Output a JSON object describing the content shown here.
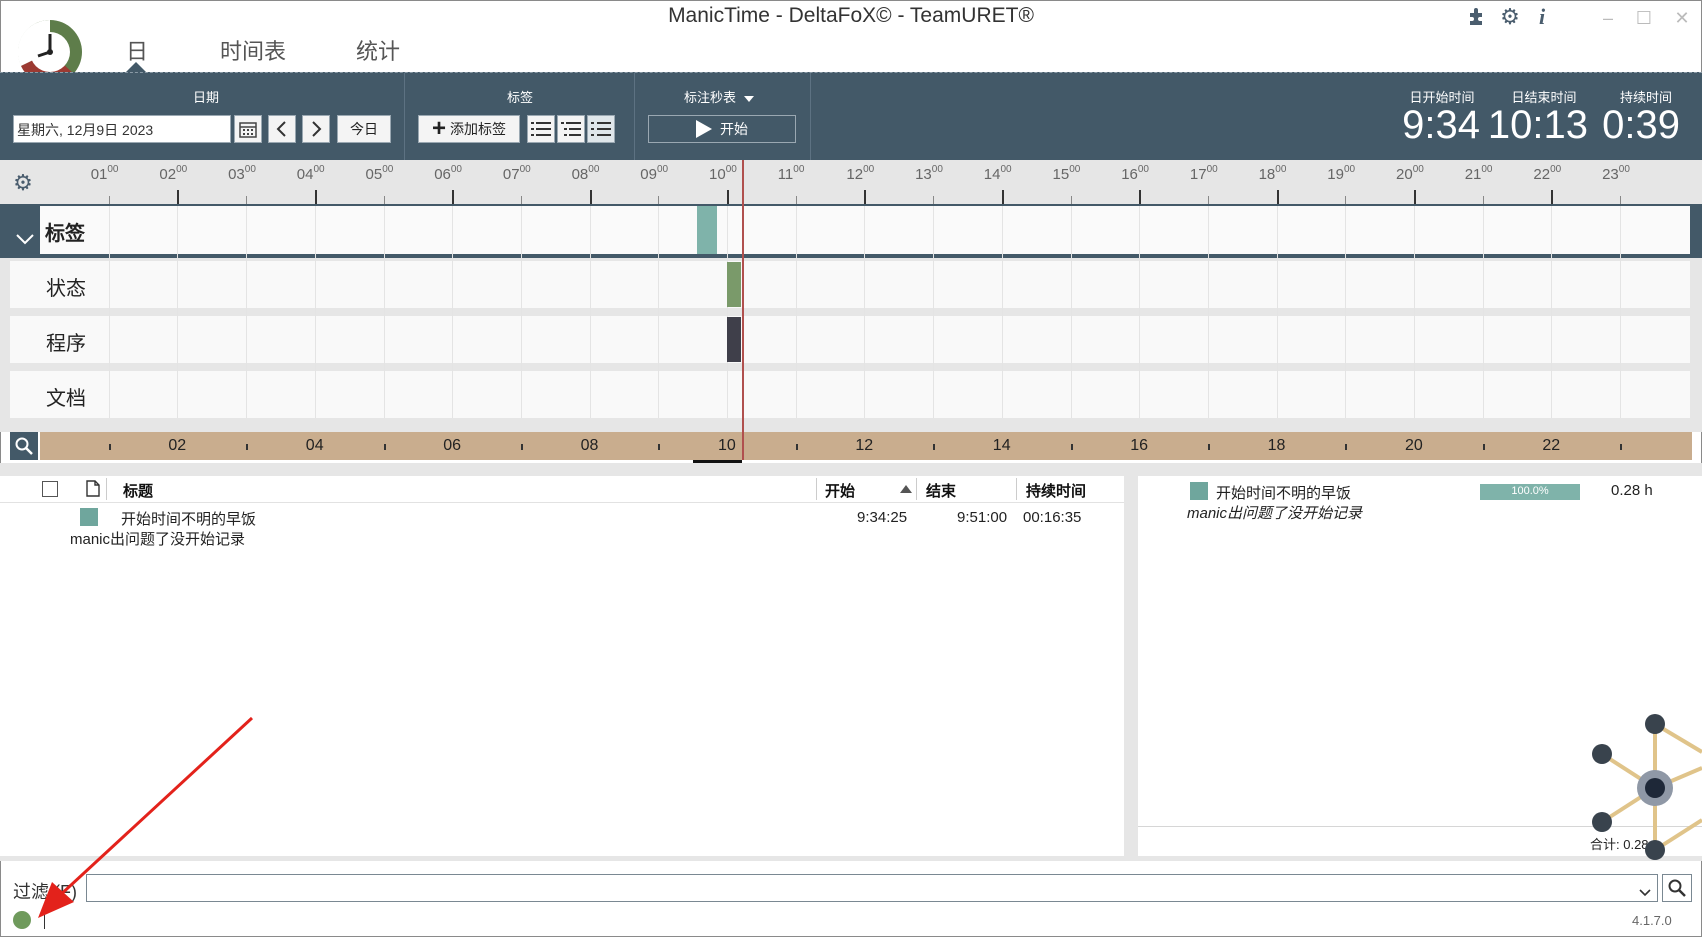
{
  "window": {
    "title": "ManicTime - DeltaFoX© - TeamURET®",
    "controls": [
      "minimize-icon",
      "maximize-icon",
      "close-icon"
    ]
  },
  "nav_tabs": [
    {
      "label": "日",
      "active": true
    },
    {
      "label": "时间表"
    },
    {
      "label": "统计"
    }
  ],
  "top_icons": [
    "plugin-icon",
    "gear-icon",
    "info-icon"
  ],
  "toolbar": {
    "date_section_label": "日期",
    "date_value": "星期六, 12月9日 2023",
    "today_label": "今日",
    "tags_section_label": "标签",
    "add_tag_label": "添加标签",
    "stopwatch_label": "标注秒表",
    "start_label": "开始",
    "day_start_label": "日开始时间",
    "day_start_value": "9:34",
    "day_end_label": "日结束时间",
    "day_end_value": "10:13",
    "duration_label": "持续时间",
    "duration_value": "0:39"
  },
  "timeline": {
    "hours": [
      "01",
      "02",
      "03",
      "04",
      "05",
      "06",
      "07",
      "08",
      "09",
      "10",
      "11",
      "12",
      "13",
      "14",
      "15",
      "16",
      "17",
      "18",
      "19",
      "20",
      "21",
      "22",
      "23"
    ],
    "hour_suffix": "00",
    "rows": [
      "标签",
      "状态",
      "程序",
      "文档"
    ],
    "nav_labels": [
      "02",
      "04",
      "06",
      "08",
      "10",
      "12",
      "14",
      "16",
      "18",
      "20",
      "22"
    ],
    "current_time_hour": 10.22,
    "tag_block": {
      "start_hour": 9.57,
      "end_hour": 9.85,
      "color": "#7fb3aa"
    },
    "status_block": {
      "start_hour": 10.0,
      "end_hour": 10.2,
      "color": "#7a9a6a"
    },
    "program_block": {
      "start_hour": 10.0,
      "end_hour": 10.2,
      "color": "#3f3f4a"
    }
  },
  "tag_list": {
    "columns": {
      "title": "标题",
      "start": "开始",
      "end": "结束",
      "duration": "持续时间"
    },
    "rows": [
      {
        "title": "开始时间不明的早饭",
        "note": "manic出问题了没开始记录",
        "start": "9:34:25",
        "end": "9:51:00",
        "duration": "00:16:35",
        "color": "#6fa69d"
      }
    ]
  },
  "summary": {
    "title": "开始时间不明的早饭",
    "note": "manic出问题了没开始记录",
    "percent_label": "100.0%",
    "percent": 100,
    "hours": "0.28 h",
    "total_label": "合计: 0.28 h"
  },
  "filter": {
    "label": "过滤 (F)",
    "value": ""
  },
  "status": {
    "version": "4.1.7.0",
    "indicator_color": "#6f9a5c"
  }
}
